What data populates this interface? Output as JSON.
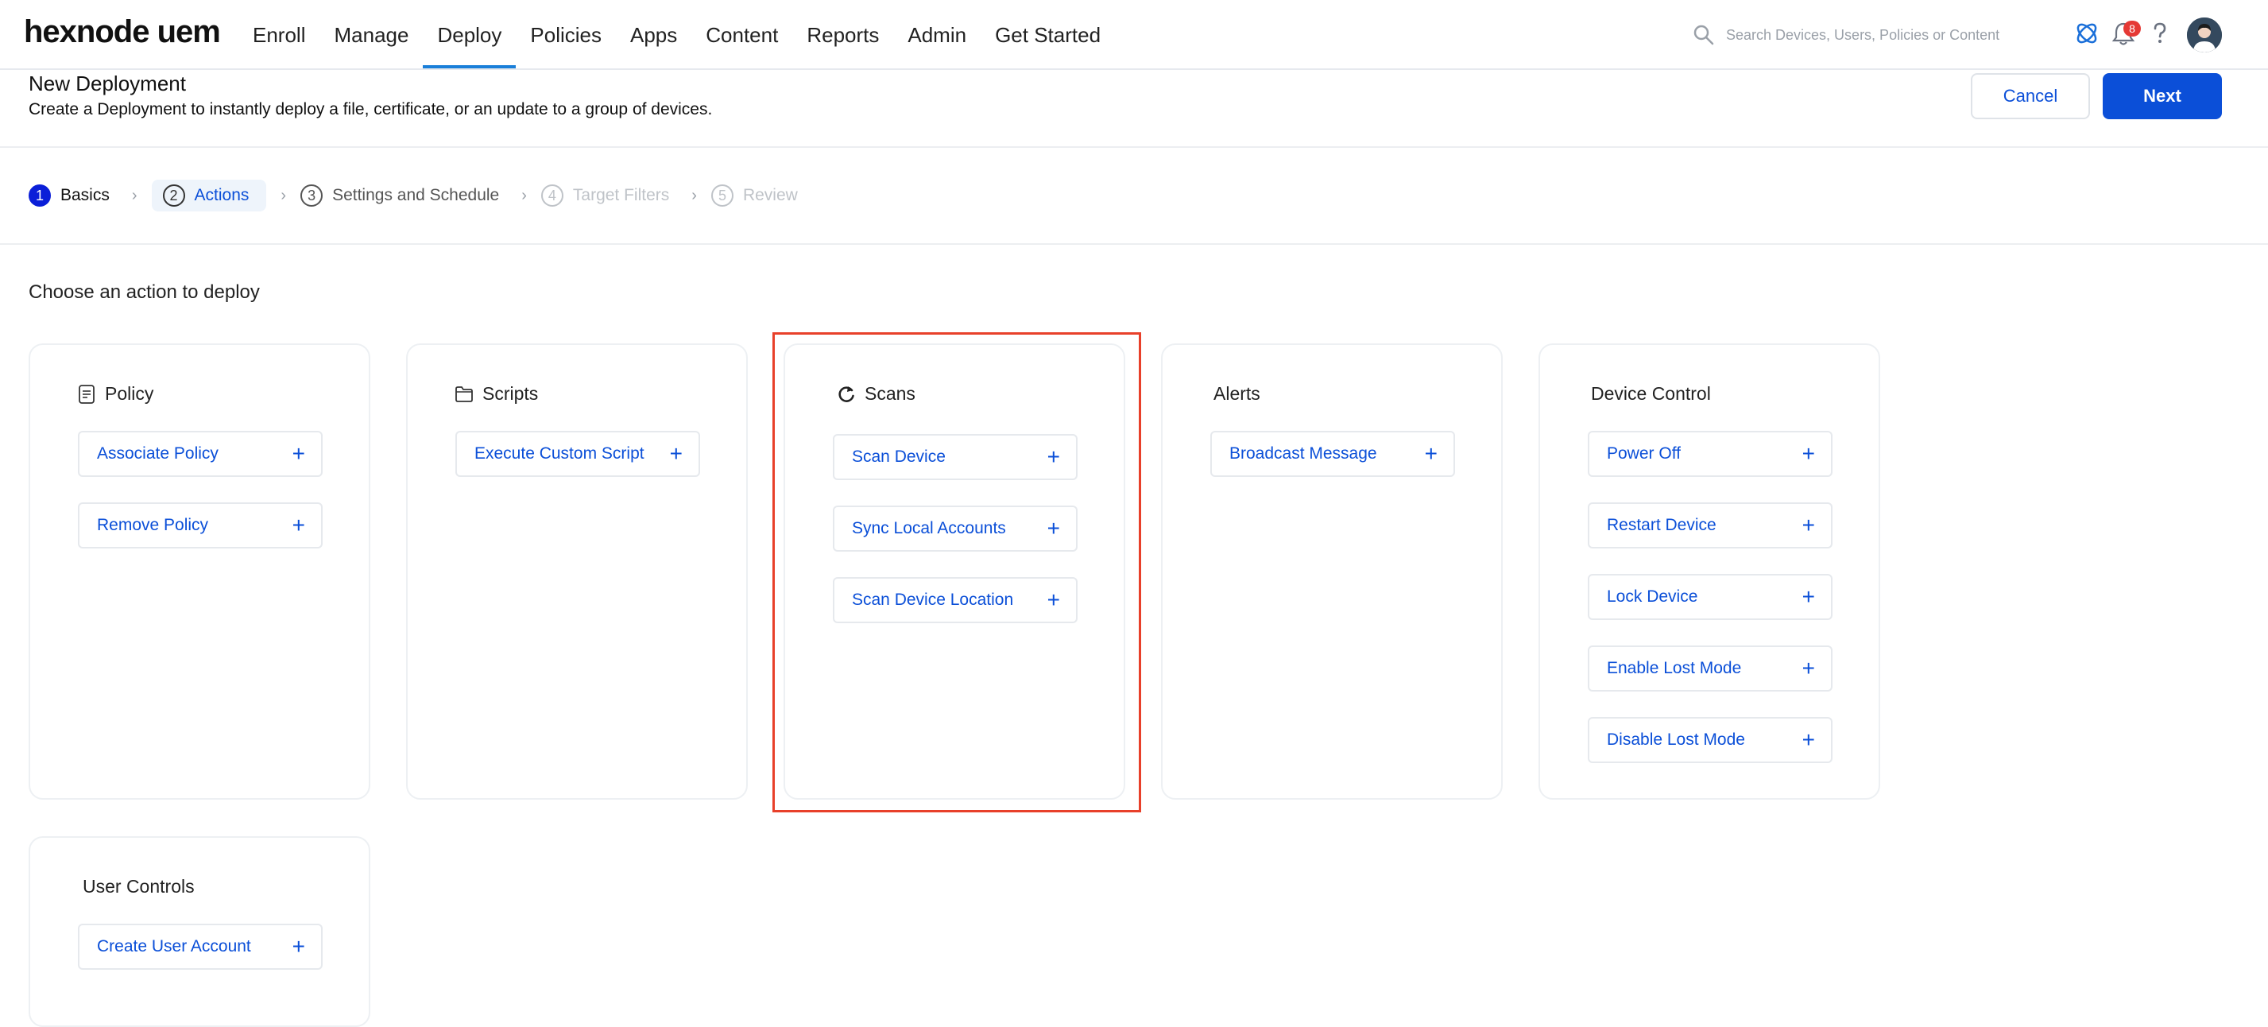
{
  "app": {
    "logo": "hexnode uem"
  },
  "nav": {
    "items": [
      "Enroll",
      "Manage",
      "Deploy",
      "Policies",
      "Apps",
      "Content",
      "Reports",
      "Admin",
      "Get Started"
    ],
    "active": "Deploy"
  },
  "search": {
    "placeholder": "Search Devices, Users, Policies or Content"
  },
  "notifications": {
    "count": "8"
  },
  "header": {
    "title": "New Deployment",
    "subtitle": "Create a Deployment to instantly deploy a file, certificate, or an update to a group of devices.",
    "cancel_label": "Cancel",
    "next_label": "Next"
  },
  "stepper": [
    {
      "num": "1",
      "label": "Basics",
      "state": "done"
    },
    {
      "num": "2",
      "label": "Actions",
      "state": "current"
    },
    {
      "num": "3",
      "label": "Settings and Schedule",
      "state": "pending"
    },
    {
      "num": "4",
      "label": "Target Filters",
      "state": "disabled"
    },
    {
      "num": "5",
      "label": "Review",
      "state": "disabled"
    }
  ],
  "section": {
    "title": "Choose an action to deploy"
  },
  "cards": {
    "policy": {
      "title": "Policy",
      "icon": "document-icon",
      "actions": [
        "Associate Policy",
        "Remove Policy"
      ]
    },
    "scripts": {
      "title": "Scripts",
      "icon": "folder-icon",
      "actions": [
        "Execute Custom Script"
      ]
    },
    "scans": {
      "title": "Scans",
      "icon": "refresh-icon",
      "actions": [
        "Scan Device",
        "Sync Local Accounts",
        "Scan Device Location"
      ]
    },
    "alerts": {
      "title": "Alerts",
      "actions": [
        "Broadcast Message"
      ]
    },
    "device_control": {
      "title": "Device Control",
      "actions": [
        "Power Off",
        "Restart Device",
        "Lock Device",
        "Enable Lost Mode",
        "Disable Lost Mode"
      ]
    },
    "user_controls": {
      "title": "User Controls",
      "actions": [
        "Create User Account"
      ]
    }
  },
  "colors": {
    "accent": "#0b4fd8",
    "highlight": "#e8402a",
    "nav_underline": "#1a7fd9"
  },
  "plus_glyph": "+"
}
